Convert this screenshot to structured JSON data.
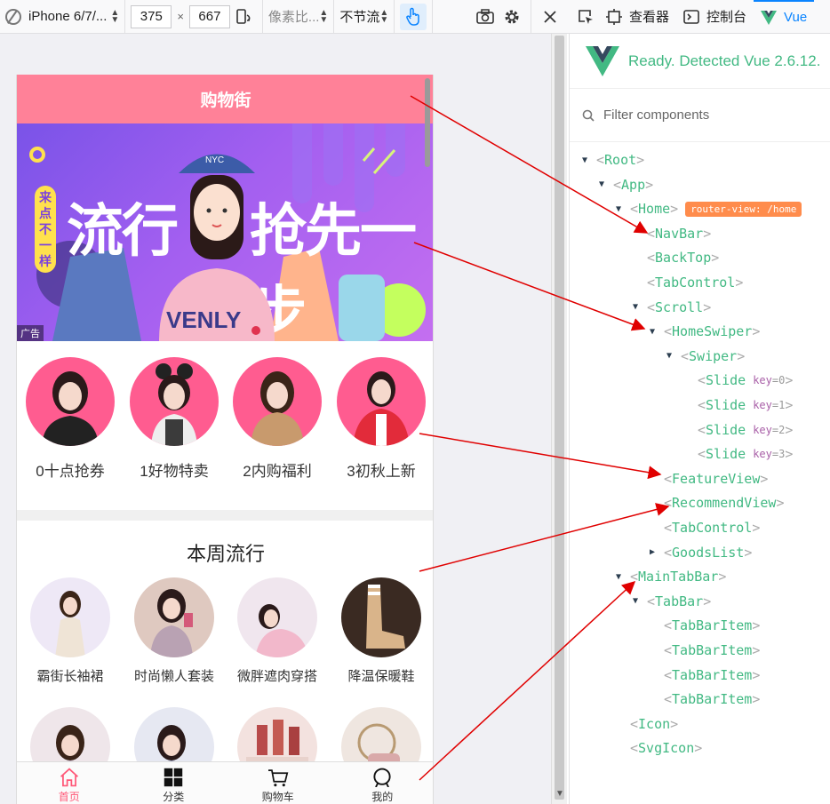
{
  "toolbar": {
    "device": "iPhone 6/7/...",
    "width": "375",
    "times": "×",
    "height": "667",
    "dpr": "像素比...",
    "throttle": "不节流"
  },
  "devtools_tabs": {
    "inspector": "查看器",
    "console": "控制台",
    "vue": "Vue"
  },
  "phone": {
    "navbar_title": "购物街",
    "banner": {
      "title_left": "流行",
      "title_right": "抢先一步",
      "badge": "来点不一样",
      "ad_label": "广告",
      "shirt_text": "NYC",
      "shirt_big": "VENLY"
    },
    "recommend": [
      {
        "label": "0十点抢券"
      },
      {
        "label": "1好物特卖"
      },
      {
        "label": "2内购福利"
      },
      {
        "label": "3初秋上新"
      }
    ],
    "feature_title": "本周流行",
    "features": [
      {
        "label": "霸街长袖裙"
      },
      {
        "label": "时尚懒人套装"
      },
      {
        "label": "微胖遮肉穿搭"
      },
      {
        "label": "降温保暖鞋"
      }
    ],
    "tabbar": [
      {
        "label": "首页",
        "icon": "home-icon",
        "active": true
      },
      {
        "label": "分类",
        "icon": "category-icon",
        "active": false
      },
      {
        "label": "购物车",
        "icon": "cart-icon",
        "active": false
      },
      {
        "label": "我的",
        "icon": "profile-icon",
        "active": false
      }
    ]
  },
  "vue": {
    "status": "Ready. Detected Vue 2.6.12.",
    "filter_placeholder": "Filter components",
    "tree": [
      {
        "name": "Root",
        "arrow": "▼",
        "depth": 0
      },
      {
        "name": "App",
        "arrow": "▼",
        "depth": 1
      },
      {
        "name": "Home",
        "arrow": "▼",
        "depth": 2,
        "badge": "router-view: /home"
      },
      {
        "name": "NavBar",
        "arrow": "",
        "depth": 3
      },
      {
        "name": "BackTop",
        "arrow": "",
        "depth": 3
      },
      {
        "name": "TabControl",
        "arrow": "",
        "depth": 3
      },
      {
        "name": "Scroll",
        "arrow": "▼",
        "depth": 3
      },
      {
        "name": "HomeSwiper",
        "arrow": "▼",
        "depth": 4
      },
      {
        "name": "Swiper",
        "arrow": "▼",
        "depth": 5
      },
      {
        "name": "Slide",
        "arrow": "",
        "depth": 6,
        "key": "key",
        "kval": "=0"
      },
      {
        "name": "Slide",
        "arrow": "",
        "depth": 6,
        "key": "key",
        "kval": "=1"
      },
      {
        "name": "Slide",
        "arrow": "",
        "depth": 6,
        "key": "key",
        "kval": "=2"
      },
      {
        "name": "Slide",
        "arrow": "",
        "depth": 6,
        "key": "key",
        "kval": "=3"
      },
      {
        "name": "FeatureView",
        "arrow": "",
        "depth": 4
      },
      {
        "name": "RecommendView",
        "arrow": "",
        "depth": 4
      },
      {
        "name": "TabControl",
        "arrow": "",
        "depth": 4
      },
      {
        "name": "GoodsList",
        "arrow": "▶",
        "depth": 4
      },
      {
        "name": "MainTabBar",
        "arrow": "▼",
        "depth": 2
      },
      {
        "name": "TabBar",
        "arrow": "▼",
        "depth": 3
      },
      {
        "name": "TabBarItem",
        "arrow": "",
        "depth": 4
      },
      {
        "name": "TabBarItem",
        "arrow": "",
        "depth": 4
      },
      {
        "name": "TabBarItem",
        "arrow": "",
        "depth": 4
      },
      {
        "name": "TabBarItem",
        "arrow": "",
        "depth": 4
      },
      {
        "name": "Icon",
        "arrow": "",
        "depth": 2
      },
      {
        "name": "SvgIcon",
        "arrow": "",
        "depth": 2
      }
    ]
  },
  "colors": {
    "navbar": "#ff8198",
    "vue_green": "#42b983",
    "arrow": "#e00000",
    "active_tab": "#ff5777"
  }
}
